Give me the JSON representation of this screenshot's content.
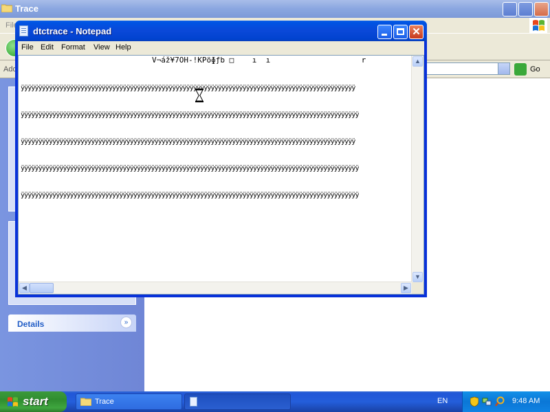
{
  "explorer": {
    "title": "Trace",
    "menu_first": "File",
    "address_label": "Address",
    "go_label": "Go",
    "details_label": "Details"
  },
  "notepad": {
    "title": "dtctrace - Notepad",
    "menu": [
      "File",
      "Edit",
      "Format",
      "View",
      "Help"
    ],
    "header_line": "V¬áž¥7OH-!KPöɸƒb □    ı  ı                    r",
    "content_lines": [
      "ÿÿÿÿÿÿÿÿÿÿÿÿÿÿÿÿÿÿÿÿÿÿÿÿÿÿÿÿÿÿÿÿÿÿÿÿÿÿÿÿÿÿÿÿÿÿÿÿÿÿÿÿÿÿÿÿÿÿÿÿÿÿÿÿÿÿÿÿÿÿÿÿÿÿÿÿÿÿÿÿÿÿÿÿÿÿÿÿÿÿÿÿÿÿÿ",
      "ÿÿÿÿÿÿÿÿÿÿÿÿÿÿÿÿÿÿÿÿÿÿÿÿÿÿÿÿÿÿÿÿÿÿÿÿÿÿÿÿÿÿÿÿÿÿÿÿÿÿÿÿÿÿÿÿÿÿÿÿÿÿÿÿÿÿÿÿÿÿÿÿÿÿÿÿÿÿÿÿÿÿÿÿÿÿÿÿÿÿÿÿÿÿÿÿ",
      "ÿÿÿÿÿÿÿÿÿÿÿÿÿÿÿÿÿÿÿÿÿÿÿÿÿÿÿÿÿÿÿÿÿÿÿÿÿÿÿÿÿÿÿÿÿÿÿÿÿÿÿÿÿÿÿÿÿÿÿÿÿÿÿÿÿÿÿÿÿÿÿÿÿÿÿÿÿÿÿÿÿÿÿÿÿÿÿÿÿÿÿÿÿÿÿ",
      "ÿÿÿÿÿÿÿÿÿÿÿÿÿÿÿÿÿÿÿÿÿÿÿÿÿÿÿÿÿÿÿÿÿÿÿÿÿÿÿÿÿÿÿÿÿÿÿÿÿÿÿÿÿÿÿÿÿÿÿÿÿÿÿÿÿÿÿÿÿÿÿÿÿÿÿÿÿÿÿÿÿÿÿÿÿÿÿÿÿÿÿÿÿÿÿÿ",
      "ÿÿÿÿÿÿÿÿÿÿÿÿÿÿÿÿÿÿÿÿÿÿÿÿÿÿÿÿÿÿÿÿÿÿÿÿÿÿÿÿÿÿÿÿÿÿÿÿÿÿÿÿÿÿÿÿÿÿÿÿÿÿÿÿÿÿÿÿÿÿÿÿÿÿÿÿÿÿÿÿÿÿÿÿÿÿÿÿÿÿÿÿÿÿÿÿ"
    ]
  },
  "taskbar": {
    "start_label": "start",
    "tasks": [
      {
        "label": "Trace",
        "icon": "folder-icon"
      },
      {
        "label": "",
        "icon": "notepad-icon"
      }
    ],
    "language": "EN",
    "clock": "9:48 AM"
  },
  "colors": {
    "xp_blue": "#0054e3",
    "start_green": "#3c9a3c",
    "tray_blue": "#0b77d6"
  }
}
